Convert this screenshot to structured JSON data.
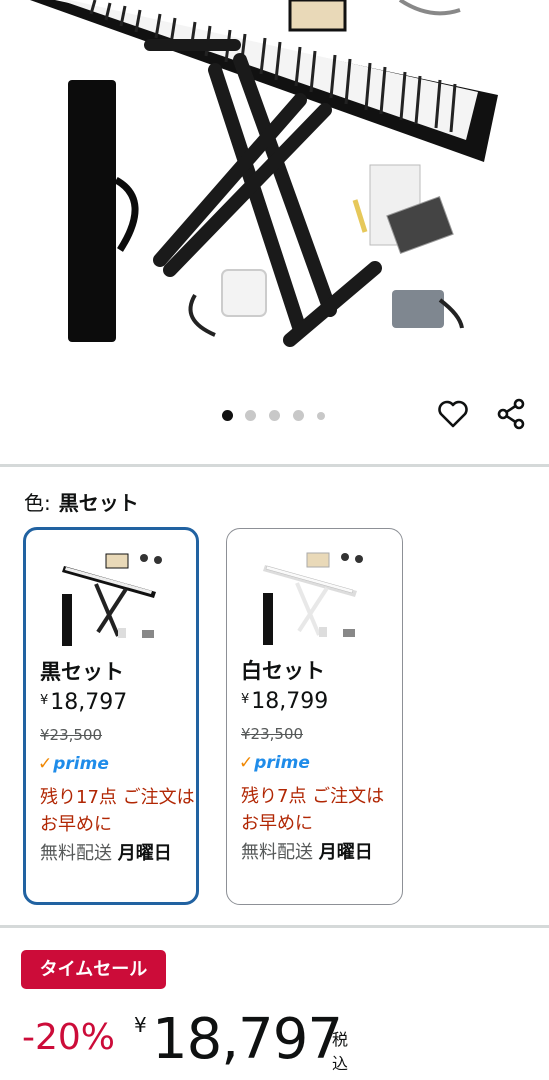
{
  "gallery": {
    "dot_count": 5,
    "active_index": 0
  },
  "color": {
    "label": "色:",
    "value": "黒セット"
  },
  "variants": [
    {
      "name": "黒セット",
      "price_symbol": "¥",
      "price": "18,797",
      "list_price": "¥23,500",
      "prime": "prime",
      "stock": "残り17点 ご注文はお早めに",
      "delivery_prefix": "無料配送 ",
      "delivery_day": "月曜日",
      "selected": true
    },
    {
      "name": "白セット",
      "price_symbol": "¥",
      "price": "18,799",
      "list_price": "¥23,500",
      "prime": "prime",
      "stock": "残り7点 ご注文はお早めに",
      "delivery_prefix": "無料配送 ",
      "delivery_day": "月曜日",
      "selected": false
    }
  ],
  "deal": {
    "badge": "タイムセール",
    "discount": "-20%",
    "currency": "¥",
    "price": "18,797",
    "tax_note": "税込"
  },
  "colors": {
    "deal_red": "#cc0c39",
    "selected_border": "#2162a1",
    "stock_red": "#b12704",
    "prime_blue": "#1f8ce9"
  },
  "icons": [
    "heart-icon",
    "share-icon",
    "prime-check-icon"
  ]
}
